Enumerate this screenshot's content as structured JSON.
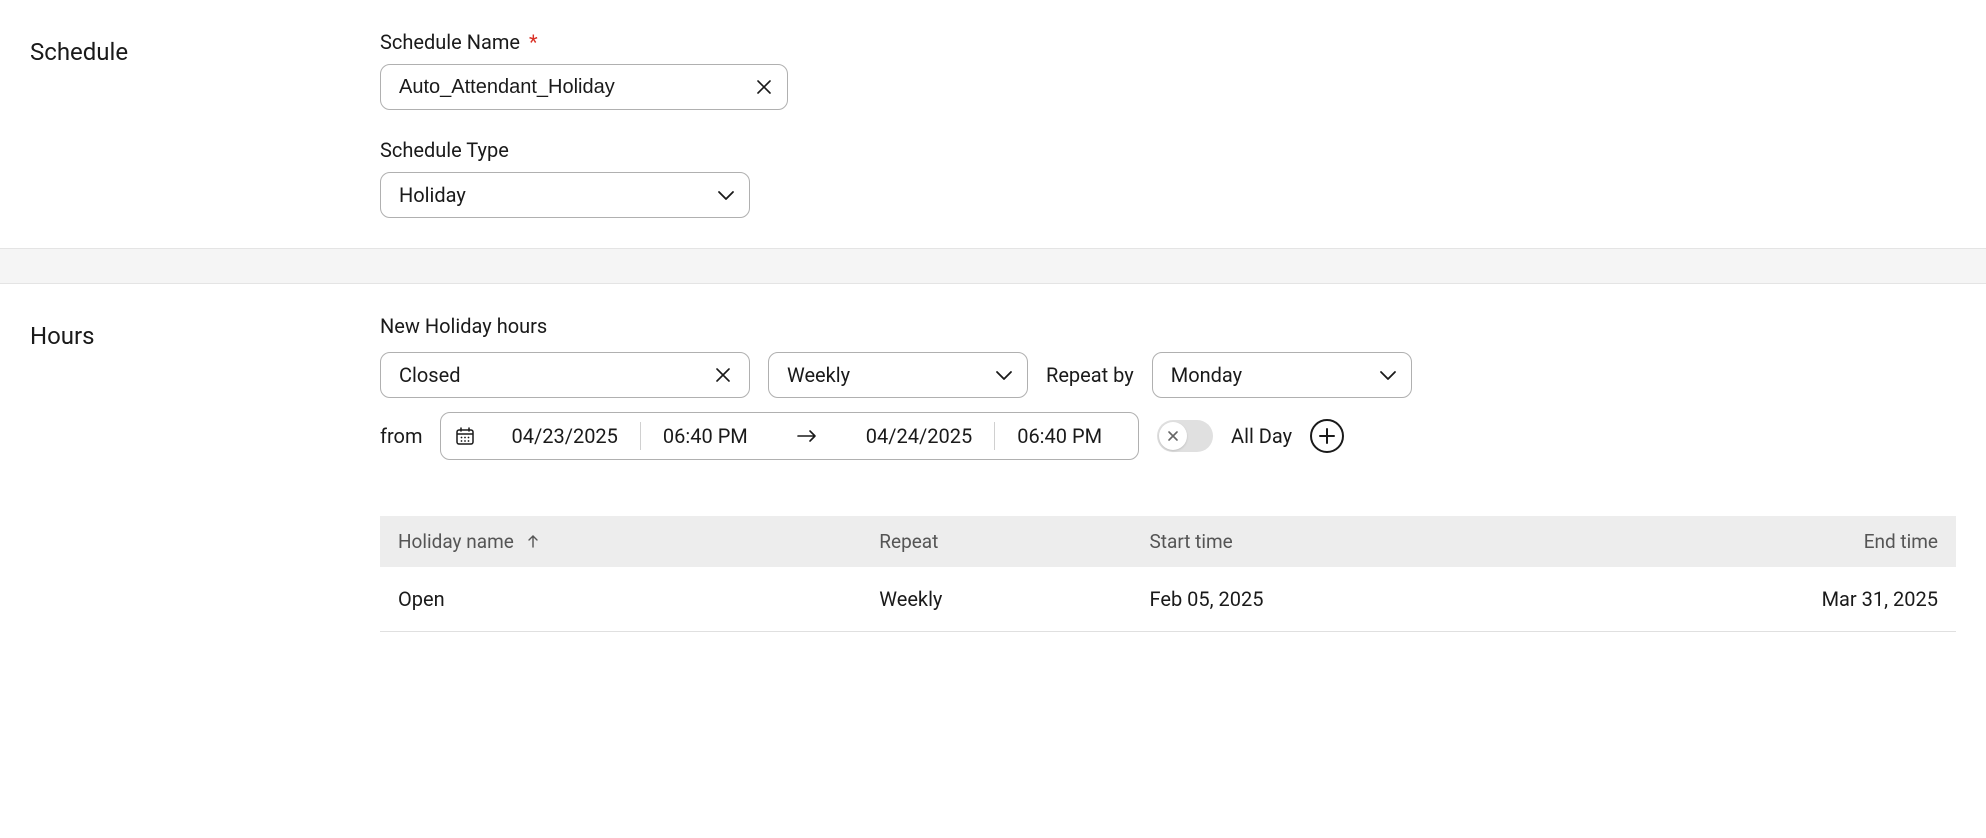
{
  "schedule": {
    "section_label": "Schedule",
    "name_label": "Schedule Name",
    "name_value": "Auto_Attendant_Holiday",
    "type_label": "Schedule Type",
    "type_value": "Holiday"
  },
  "hours": {
    "section_label": "Hours",
    "new_label": "New Holiday hours",
    "status_value": "Closed",
    "repeat_value": "Weekly",
    "repeat_by_label": "Repeat by",
    "repeat_day_value": "Monday",
    "from_label": "from",
    "start_date": "04/23/2025",
    "start_time": "06:40 PM",
    "end_date": "04/24/2025",
    "end_time": "06:40 PM",
    "allday_label": "All Day"
  },
  "table": {
    "headers": {
      "name": "Holiday name",
      "repeat": "Repeat",
      "start": "Start time",
      "end": "End time"
    },
    "rows": [
      {
        "name": "Open",
        "repeat": "Weekly",
        "start": "Feb 05, 2025",
        "end": "Mar 31, 2025"
      }
    ]
  }
}
